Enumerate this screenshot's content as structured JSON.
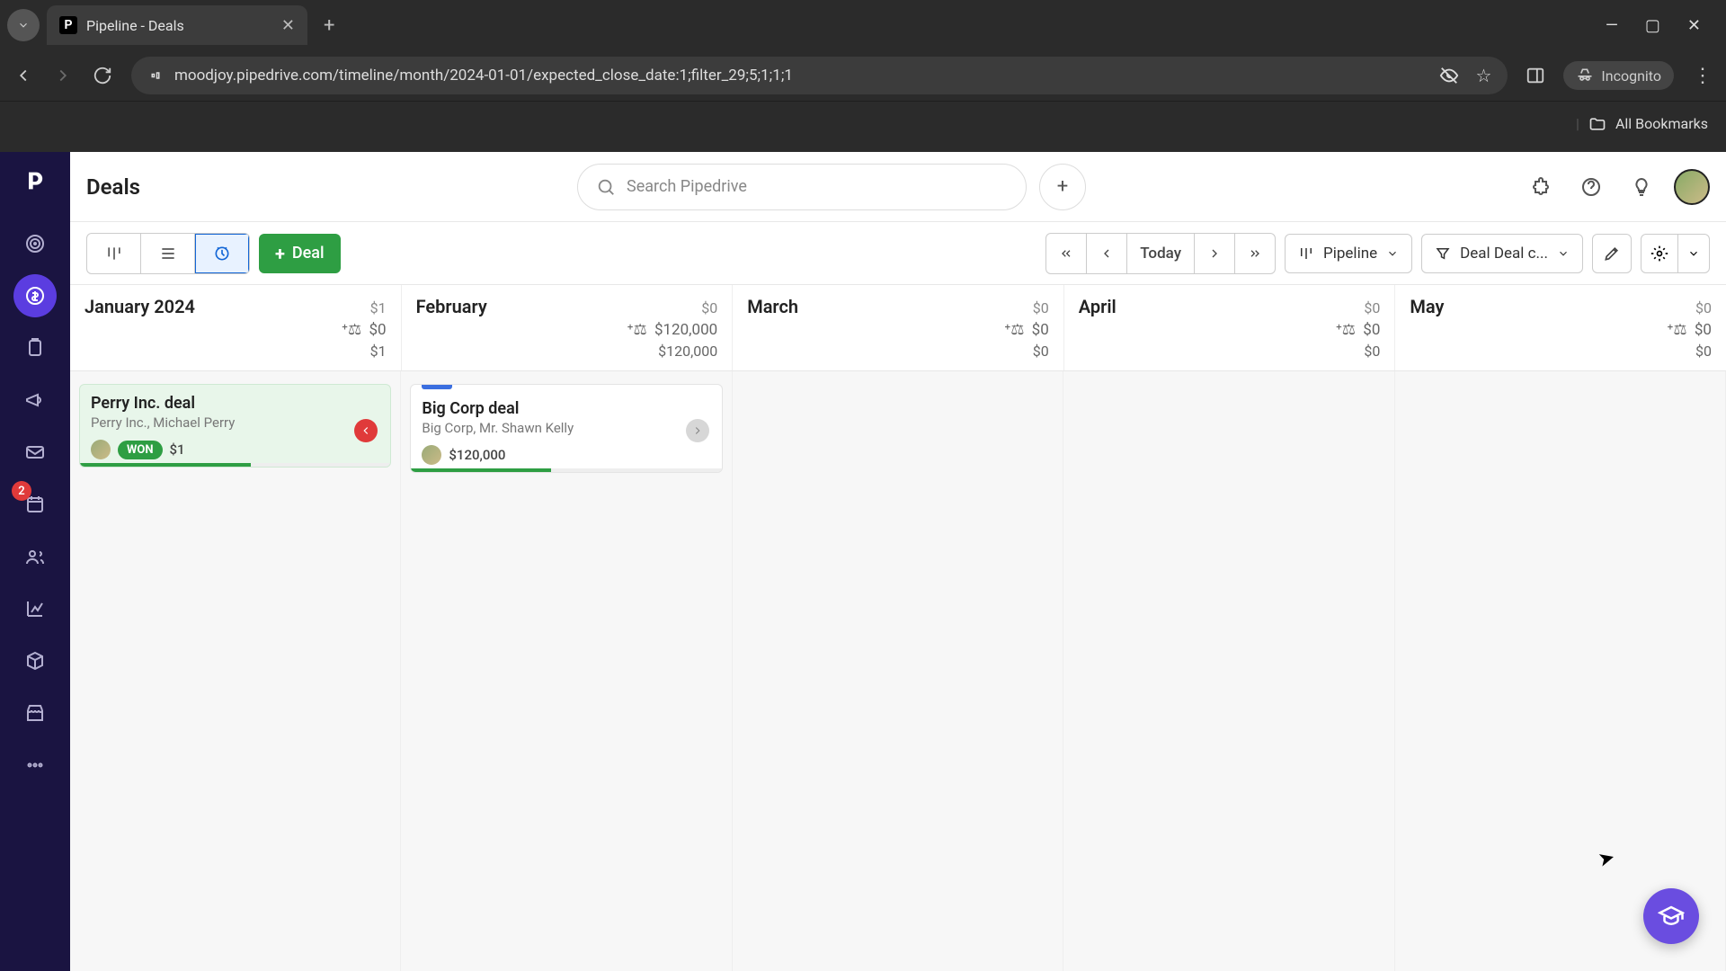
{
  "browser": {
    "tab_title": "Pipeline - Deals",
    "url": "moodjoy.pipedrive.com/timeline/month/2024-01-01/expected_close_date:1;filter_29;5;1;1;1",
    "incognito_label": "Incognito",
    "bookmarks_label": "All Bookmarks"
  },
  "header": {
    "page_title": "Deals",
    "search_placeholder": "Search Pipedrive"
  },
  "toolbar": {
    "add_deal_label": "Deal",
    "today_label": "Today",
    "pipeline_label": "Pipeline",
    "filter_label": "Deal Deal c..."
  },
  "sidebar": {
    "activity_badge": "2"
  },
  "timeline": {
    "months": [
      {
        "name": "January 2024",
        "top": "$1",
        "weighted": "$0",
        "bottom": "$1"
      },
      {
        "name": "February",
        "top": "$0",
        "weighted": "$120,000",
        "bottom": "$120,000"
      },
      {
        "name": "March",
        "top": "$0",
        "weighted": "$0",
        "bottom": "$0"
      },
      {
        "name": "April",
        "top": "$0",
        "weighted": "$0",
        "bottom": "$0"
      },
      {
        "name": "May",
        "top": "$0",
        "weighted": "$0",
        "bottom": "$0"
      }
    ]
  },
  "deals": {
    "january": {
      "title": "Perry Inc. deal",
      "subtitle": "Perry Inc., Michael Perry",
      "badge": "WON",
      "amount": "$1",
      "progress_pct": 55
    },
    "february": {
      "title": "Big Corp deal",
      "subtitle": "Big Corp, Mr. Shawn Kelly",
      "amount": "$120,000",
      "progress_pct": 45
    }
  }
}
